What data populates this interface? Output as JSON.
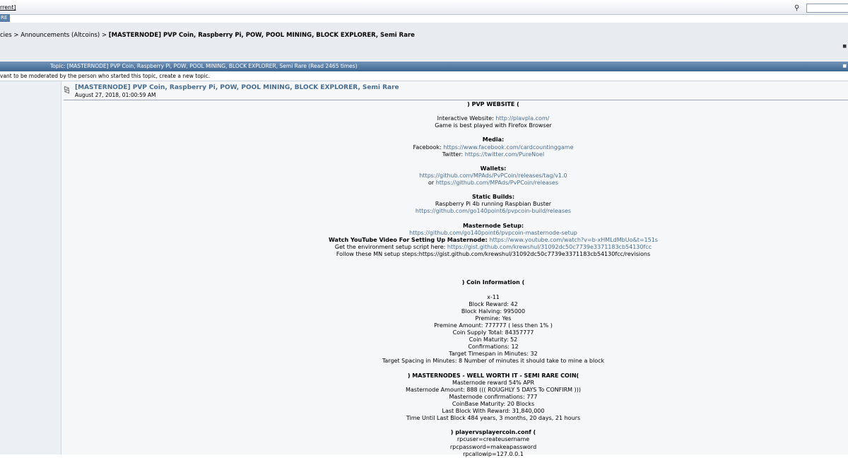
{
  "topbar": {
    "recent_label": "rrent]",
    "tab_label": "RE"
  },
  "breadcrumb": {
    "prefix": "cies > Announcements (Altcoins) > ",
    "current": "[MASTERNODE] PVP Coin, Raspberry Pi, POW, POOL MINING, BLOCK EXPLORER, Semi Rare"
  },
  "topic_bar": {
    "label": "Topic: [MASTERNODE] PVP Coin, Raspberry Pi, POW, POOL MINING, BLOCK EXPLORER, Semi Rare  (Read 2465 times)"
  },
  "notice": "vant to be moderated by the person who started this topic, create a new topic.",
  "post": {
    "title": "[MASTERNODE] PVP Coin, Raspberry Pi, POW, POOL MINING, BLOCK EXPLORER, Semi Rare",
    "date": "August 27, 2018, 01:00:59 AM"
  },
  "content": {
    "website_heading": ") PVP WEBSITE (",
    "interactive_label": "Interactive Website: ",
    "interactive_url": "http://plavpla.com/",
    "firefox_note": "Game is best played with Firefox Browser",
    "media_heading": "Media:",
    "facebook_label": "Facebook: ",
    "facebook_url": "https://www.facebook.com/cardcountinggame",
    "twitter_label": "Twitter: ",
    "twitter_url": "https://twitter.com/PureNoel",
    "wallets_heading": "Wallets:",
    "wallet_url_1": "https://github.com/MPAds/PvPCoin/releases/tag/v1.0",
    "wallet_or": "or ",
    "wallet_url_2": "https://github.com/MPAds/PvPCoin/releases",
    "builds_heading": "Static Builds:",
    "builds_text": "Raspberry Pi 4b running Raspbian Buster",
    "builds_url": "https://github.com/go140point6/pvpcoin-build/releases",
    "mn_setup_heading": "Masternode Setup:",
    "mn_setup_url": "https://github.com/go140point6/pvpcoin-masternode-setup",
    "yt_label": "Watch YouTube Video For Setting Up Masternode: ",
    "yt_url": "https://www.youtube.com/watch?v=b-xHMLdMbUo&t=151s",
    "env_label": "Get the environment setup script here: ",
    "env_url": "https://gist.github.com/krewshul/31092dc50c7739e3371183cb54130fcc",
    "follow_text": "Follow these MN setup steps:https://gist.github.com/krewshul/31092dc50c7739e3371183cb54130fcc/revisions",
    "coin_heading": ") Coin Information (",
    "coin_lines": [
      "x-11",
      "Block Reward: 42",
      "Block Halving: 995000",
      "Premine: Yes",
      "Premine Amount: 777777 ( less then 1% )",
      "Coin Supply Total: 84357777",
      "Coin Maturity: 52",
      "Confirmations: 12",
      "Target Timespan in Minutes: 32",
      "Target Spacing in Minutes: 8 Number of minutes it should take to mine a block"
    ],
    "mn_heading": ") MASTERNODES - WELL WORTH IT - SEMI RARE COIN(",
    "mn_lines": [
      "Masternode reward 54% APR",
      "Masternode Amount: 888    ((( ROUGHLY 5 DAYS To CONFIRM )))",
      "Masternode confirmations: 777",
      "CoinBase Maturity: 20 Blocks",
      "Last Block With Reward: 31,840,000",
      "Time Until Last Block 484 years, 3 months, 20 days, 21 hours"
    ],
    "conf_heading": ") playervsplayercoin.conf (",
    "conf_lines": [
      "rpcuser=createusername",
      "rpcpassword=makeapassword",
      "rpcallowip=127.0.0.1"
    ]
  }
}
